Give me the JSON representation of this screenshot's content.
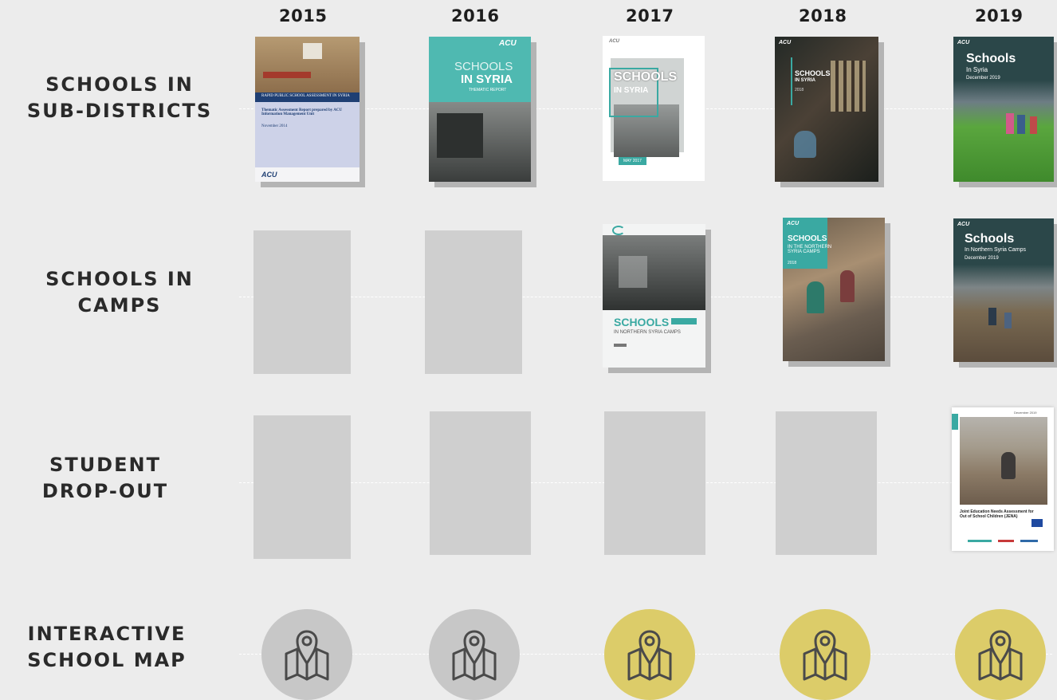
{
  "years": [
    "2015",
    "2016",
    "2017",
    "2018",
    "2019"
  ],
  "rows": {
    "sub_districts": {
      "line1": "SCHOOLS IN",
      "line2": "SUB-DISTRICTS"
    },
    "camps": {
      "line1": "SCHOOLS IN",
      "line2": "CAMPS"
    },
    "dropout": {
      "line1": "STUDENT",
      "line2": "DROP-OUT"
    },
    "map": {
      "line1": "INTERACTIVE",
      "line2": "SCHOOL MAP"
    }
  },
  "covers": {
    "sub_2015": {
      "headline": "RAPID PUBLIC SCHOOL ASSESSMENT IN SYRIA",
      "subtitle": "Thematic Assessment Report prepared by ACU Information Management Unit",
      "date": "November 2014",
      "logo": "ACU"
    },
    "sub_2016": {
      "title1": "SCHOOLS",
      "title2": "IN SYRIA",
      "tag": "THEMATIC REPORT",
      "logo": "ACU"
    },
    "sub_2017": {
      "title1": "SCHOOLS",
      "title2": "IN SYRIA",
      "tag": "MAY 2017",
      "logo": "ACU"
    },
    "sub_2018": {
      "title1": "SCHOOLS",
      "title2": "IN SYRIA",
      "date": "2018",
      "logo": "ACU"
    },
    "sub_2019": {
      "title1": "Schools",
      "title2": "In Syria",
      "date": "December 2019",
      "logo": "ACU"
    },
    "camps_2017": {
      "title1": "SCHOOLS",
      "title2": "IN NORTHERN SYRIA CAMPS"
    },
    "camps_2018": {
      "title1": "SCHOOLS",
      "title2": "IN THE NORTHERN SYRIA CAMPS",
      "date": "2018",
      "logo": "ACU"
    },
    "camps_2019": {
      "title1": "Schools",
      "title2": "In Northern Syria Camps",
      "date": "December 2019",
      "logo": "ACU"
    },
    "dropout_2019": {
      "date": "December 2019",
      "title": "Joint Education Needs Assessment for Out of School Children (JENA)"
    }
  },
  "map_markers": {
    "icon": "map-pin-icon",
    "states": [
      "inactive",
      "inactive",
      "active",
      "active",
      "active"
    ],
    "colors": {
      "inactive": "#c7c7c7",
      "active": "#dccc69",
      "icon": "#4a4a4a"
    }
  },
  "colors": {
    "background": "#ececec",
    "placeholder": "#cfcfcf",
    "dash": "#ffffff",
    "shadow": "#b4b4b4",
    "text": "#1e1e1e",
    "teal": "#3aa9a2"
  }
}
